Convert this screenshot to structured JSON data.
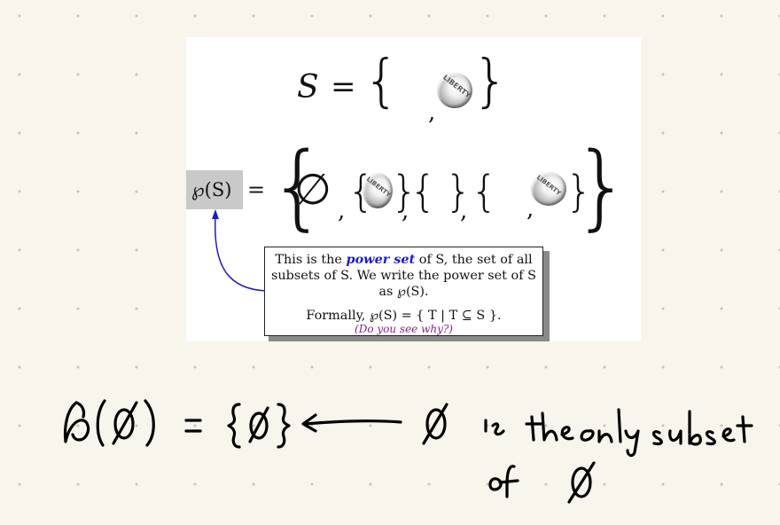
{
  "slide": {
    "set_lhs": "S",
    "set_eq": "=",
    "set_comma": ",",
    "ps_label": "℘(S)",
    "ps_eq": "=",
    "empty_set": "∅",
    "ps_commas": [
      ",",
      ",",
      ",",
      ","
    ],
    "info": {
      "text_before_power": "This is the ",
      "power_term": "power set",
      "text_after_power": " of S, the set of all subsets of S. We write the power set of S as ℘(S).",
      "formal_line": "Formally, ℘(S) = { T | T ⊆ S }.",
      "hint": "(Do you see why?)"
    }
  },
  "handwriting": {
    "line1_expr": "℘(∅) = {∅}",
    "line1_note": "∅ is the only subset",
    "line2_note": "of ∅"
  },
  "colors": {
    "background": "#f7f5ec",
    "grid_dot": "#c7c5bc",
    "power_term": "#1a1ad6",
    "hint": "#8a1e8a",
    "arrow": "#1a1ad6",
    "ink": "#000000",
    "label_box": "#c9c9c9"
  },
  "icons": [
    "coin-image"
  ]
}
